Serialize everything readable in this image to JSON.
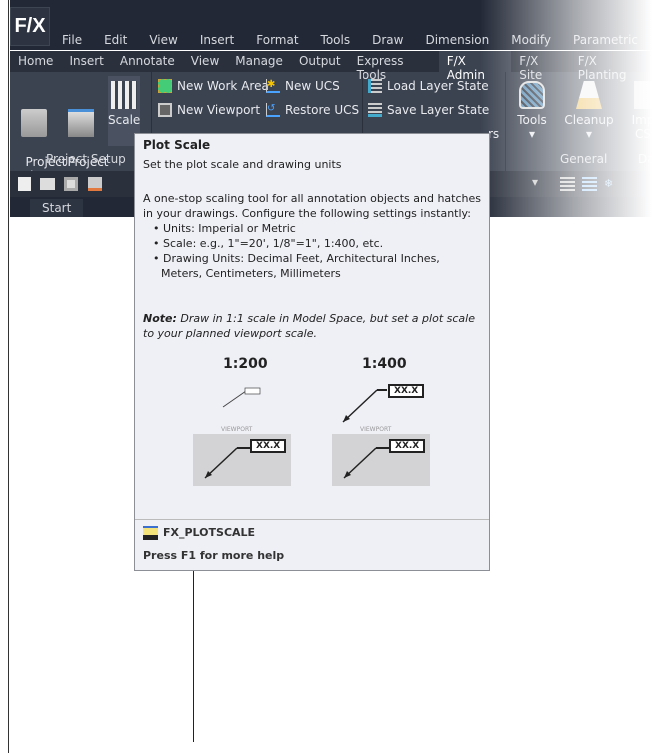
{
  "app": {
    "logo": "F/X"
  },
  "menu": [
    "File",
    "Edit",
    "View",
    "Insert",
    "Format",
    "Tools",
    "Draw",
    "Dimension",
    "Modify",
    "Parametric"
  ],
  "tabs": [
    {
      "label": "Home"
    },
    {
      "label": "Insert"
    },
    {
      "label": "Annotate"
    },
    {
      "label": "View"
    },
    {
      "label": "Manage"
    },
    {
      "label": "Output"
    },
    {
      "label": "Express Tools"
    },
    {
      "label": "F/X Admin",
      "active": true
    },
    {
      "label": "F/X Site"
    },
    {
      "label": "F/X Planting"
    }
  ],
  "ribbon": {
    "project_list": "Project\nList",
    "project_manager": "Project\nManager",
    "scale": "Scale",
    "new_work_area": "New Work Area",
    "new_viewport": "New Viewport",
    "new_ucs": "New UCS",
    "restore_ucs": "Restore UCS",
    "load_layer_state": "Load Layer State",
    "save_layer_state": "Save Layer State",
    "partial_rs": "rs",
    "tools": "Tools",
    "cleanup": "Cleanup",
    "import_partial": "Imp",
    "cs_partial": "CS",
    "panel_project_setup": "Project Setup",
    "panel_general": "General",
    "panel_da": "Da"
  },
  "filetabs": {
    "start": "Start"
  },
  "tooltip": {
    "title": "Plot Scale",
    "subtitle": "Set the plot scale and drawing units",
    "desc": "A one-stop scaling tool for all annotation objects and hatches in your drawings. Configure the following settings instantly:",
    "bullets": [
      "• Units: Imperial or Metric",
      "• Scale: e.g., 1\"=20', 1/8\"=1\", 1:400, etc.",
      "• Drawing Units: Decimal Feet, Architectural Inches, Meters, Centimeters, Millimeters"
    ],
    "note_label": "Note:",
    "note": " Draw in 1:1 scale in Model Space, but set a plot scale to your planned viewport scale.",
    "scale_a": "1:200",
    "scale_b": "1:400",
    "tag": "XX.X",
    "viewport": "VIEWPORT",
    "command": "FX_PLOTSCALE",
    "help": "Press F1 for more help"
  }
}
